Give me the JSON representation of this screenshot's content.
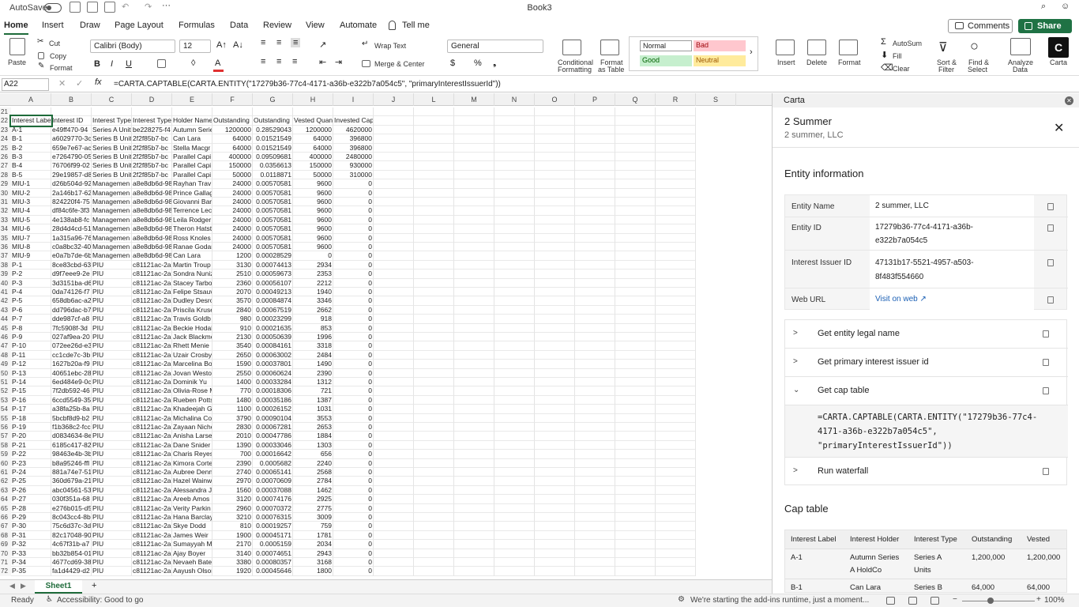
{
  "titlebar": {
    "autosave": "AutoSave",
    "title": "Book3"
  },
  "tabs": [
    "Home",
    "Insert",
    "Draw",
    "Page Layout",
    "Formulas",
    "Data",
    "Review",
    "View",
    "Automate"
  ],
  "tell_me": "Tell me",
  "comments": "Comments",
  "share": "Share",
  "ribbon": {
    "paste": "Paste",
    "cut": "Cut",
    "copy": "Copy",
    "format": "Format",
    "font_name": "Calibri (Body)",
    "font_size": "12",
    "wrap_text": "Wrap Text",
    "merge_center": "Merge & Center",
    "number_format": "General",
    "conditional_formatting_1": "Conditional",
    "conditional_formatting_2": "Formatting",
    "format_table_1": "Format",
    "format_table_2": "as Table",
    "style_normal": "Normal",
    "style_bad": "Bad",
    "style_good": "Good",
    "style_neutral": "Neutral",
    "insert": "Insert",
    "delete": "Delete",
    "format_cells": "Format",
    "autosum": "AutoSum",
    "fill": "Fill",
    "clear": "Clear",
    "sort_filter_1": "Sort &",
    "sort_filter_2": "Filter",
    "find_select_1": "Find &",
    "find_select_2": "Select",
    "analyze_1": "Analyze",
    "analyze_2": "Data",
    "carta": "Carta",
    "colors": {
      "style_normal_bg": "#ffffff",
      "style_bad_bg": "#ffc7ce",
      "style_good_bg": "#c6efce",
      "style_neutral_bg": "#ffeb9c",
      "font_color": "#e03030",
      "accent": "#1e6b3a"
    }
  },
  "formula_bar": {
    "name_box": "A22",
    "formula": "=CARTA.CAPTABLE(CARTA.ENTITY(\"17279b36-77c4-4171-a36b-e322b7a054c5\", \"primaryInterestIssuerId\"))"
  },
  "grid": {
    "columns": [
      "A",
      "B",
      "C",
      "D",
      "E",
      "F",
      "G",
      "H",
      "I",
      "J",
      "L",
      "M",
      "N",
      "O",
      "P",
      "Q",
      "R",
      "S"
    ],
    "headers": [
      "Interest Label",
      "Interest ID",
      "Interest Type",
      "Interest Type",
      "Holder Name",
      "Outstanding",
      "Outstanding",
      "Vested Quantity",
      "Invested Capital"
    ],
    "rows": [
      [
        "21",
        "",
        "",
        "",
        "",
        "",
        "",
        "",
        "",
        ""
      ],
      [
        "22",
        "Interest Label",
        "Interest ID",
        "Interest Type",
        "Interest Type",
        "Holder Name",
        "Outstanding",
        "Outstanding",
        "Vested Quan",
        "Invested Capital"
      ],
      [
        "23",
        "A-1",
        "e49ff470-94",
        "Series A Unit",
        "be228275-f4",
        "Autumn Serie",
        "1200000",
        "0.28529043",
        "1200000",
        "4620000"
      ],
      [
        "24",
        "B-1",
        "a6029770-3c",
        "Series B Unit",
        "2f2f85b7-bc",
        "Can Lara",
        "64000",
        "0.01521549",
        "64000",
        "396800"
      ],
      [
        "25",
        "B-2",
        "659e7e67-ac",
        "Series B Unit",
        "2f2f85b7-bc",
        "Stella Macgr",
        "64000",
        "0.01521549",
        "64000",
        "396800"
      ],
      [
        "26",
        "B-3",
        "e7264790-05",
        "Series B Unit",
        "2f2f85b7-bc",
        "Parallel Capi",
        "400000",
        "0.09509681",
        "400000",
        "2480000"
      ],
      [
        "27",
        "B-4",
        "76706f99-02",
        "Series B Unit",
        "2f2f85b7-bc",
        "Parallel Capi",
        "150000",
        "0.0356613",
        "150000",
        "930000"
      ],
      [
        "28",
        "B-5",
        "29e19857-d8",
        "Series B Unit",
        "2f2f85b7-bc",
        "Parallel Capi",
        "50000",
        "0.0118871",
        "50000",
        "310000"
      ],
      [
        "29",
        "MIU-1",
        "d26b504d-92",
        "Managemen",
        "a8e8db6d-98",
        "Rayhan Trav",
        "24000",
        "0.00570581",
        "9600",
        "0"
      ],
      [
        "30",
        "MIU-2",
        "2a146b17-62",
        "Managemen",
        "a8e8db6d-98",
        "Prince Gallag",
        "24000",
        "0.00570581",
        "9600",
        "0"
      ],
      [
        "31",
        "MIU-3",
        "824220f4-75",
        "Managemen",
        "a8e8db6d-98",
        "Giovanni Bar",
        "24000",
        "0.00570581",
        "9600",
        "0"
      ],
      [
        "32",
        "MIU-4",
        "df84c6fe-3f3",
        "Managemen",
        "a8e8db6d-98",
        "Terrence Lec",
        "24000",
        "0.00570581",
        "9600",
        "0"
      ],
      [
        "33",
        "MIU-5",
        "4e138ab8-fc",
        "Managemen",
        "a8e8db6d-98",
        "Leila Rodger",
        "24000",
        "0.00570581",
        "9600",
        "0"
      ],
      [
        "34",
        "MIU-6",
        "28d4d4cd-51",
        "Managemen",
        "a8e8db6d-98",
        "Theron Hatst",
        "24000",
        "0.00570581",
        "9600",
        "0"
      ],
      [
        "35",
        "MIU-7",
        "1a315a96-76",
        "Managemen",
        "a8e8db6d-98",
        "Ross Knoles",
        "24000",
        "0.00570581",
        "9600",
        "0"
      ],
      [
        "36",
        "MIU-8",
        "c0a8bc32-40",
        "Managemen",
        "a8e8db6d-98",
        "Ranae Godar",
        "24000",
        "0.00570581",
        "9600",
        "0"
      ],
      [
        "37",
        "MIU-9",
        "e0a7b7de-6b",
        "Managemen",
        "a8e8db6d-98",
        "Can Lara",
        "1200",
        "0.00028529",
        "0",
        "0"
      ],
      [
        "38",
        "P-1",
        "8ce83cbd-63",
        "PIU",
        "c81121ac-2a",
        "Martin Troup",
        "3130",
        "0.00074413",
        "2934",
        "0"
      ],
      [
        "39",
        "P-2",
        "d9f7eee9-2e",
        "PIU",
        "c81121ac-2a",
        "Sondra Nuniz",
        "2510",
        "0.00059673",
        "2353",
        "0"
      ],
      [
        "40",
        "P-3",
        "3d3151ba-d6",
        "PIU",
        "c81121ac-2a",
        "Stacey Tarbo",
        "2360",
        "0.00056107",
        "2212",
        "0"
      ],
      [
        "41",
        "P-4",
        "0da74126-f7",
        "PIU",
        "c81121ac-2a",
        "Felipe Stsauv",
        "2070",
        "0.00049213",
        "1940",
        "0"
      ],
      [
        "42",
        "P-5",
        "658db6ac-a2",
        "PIU",
        "c81121ac-2a",
        "Dudley Desro",
        "3570",
        "0.00084874",
        "3346",
        "0"
      ],
      [
        "43",
        "P-6",
        "dd796dac-b7",
        "PIU",
        "c81121ac-2a",
        "Priscila Kruse",
        "2840",
        "0.00067519",
        "2662",
        "0"
      ],
      [
        "44",
        "P-7",
        "dde987cf-a8",
        "PIU",
        "c81121ac-2a",
        "Travis Goldb",
        "980",
        "0.00023299",
        "918",
        "0"
      ],
      [
        "45",
        "P-8",
        "7fc5908f-3d",
        "PIU",
        "c81121ac-2a",
        "Beckie Hodal",
        "910",
        "0.00021635",
        "853",
        "0"
      ],
      [
        "46",
        "P-9",
        "027af9ea-20",
        "PIU",
        "c81121ac-2a",
        "Jack Blackmo",
        "2130",
        "0.00050639",
        "1996",
        "0"
      ],
      [
        "47",
        "P-10",
        "072ee26d-e3",
        "PIU",
        "c81121ac-2a",
        "Rhett Menie",
        "3540",
        "0.00084161",
        "3318",
        "0"
      ],
      [
        "48",
        "P-11",
        "cc1cde7c-3b",
        "PIU",
        "c81121ac-2a",
        "Uzair Crosby",
        "2650",
        "0.00063002",
        "2484",
        "0"
      ],
      [
        "49",
        "P-12",
        "1627b20a-f9",
        "PIU",
        "c81121ac-2a",
        "Marcelina Bo",
        "1590",
        "0.00037801",
        "1490",
        "0"
      ],
      [
        "50",
        "P-13",
        "40651ebc-28",
        "PIU",
        "c81121ac-2a",
        "Jovan Westo",
        "2550",
        "0.00060624",
        "2390",
        "0"
      ],
      [
        "51",
        "P-14",
        "6ed484e9-0c",
        "PIU",
        "c81121ac-2a",
        "Dominik Yu",
        "1400",
        "0.00033284",
        "1312",
        "0"
      ],
      [
        "52",
        "P-15",
        "7f2db592-46",
        "PIU",
        "c81121ac-2a",
        "Olivia-Rose M",
        "770",
        "0.00018306",
        "721",
        "0"
      ],
      [
        "53",
        "P-16",
        "6ccd5549-35",
        "PIU",
        "c81121ac-2a",
        "Rueben Potts",
        "1480",
        "0.00035186",
        "1387",
        "0"
      ],
      [
        "54",
        "P-17",
        "a38fa25b-8a",
        "PIU",
        "c81121ac-2a",
        "Khadeejah G",
        "1100",
        "0.00026152",
        "1031",
        "0"
      ],
      [
        "55",
        "P-18",
        "5bcbf8d9-b2",
        "PIU",
        "c81121ac-2a",
        "Michalina Co",
        "3790",
        "0.00090104",
        "3553",
        "0"
      ],
      [
        "56",
        "P-19",
        "f1b368c2-fcc",
        "PIU",
        "c81121ac-2a",
        "Zayaan Nicho",
        "2830",
        "0.00067281",
        "2653",
        "0"
      ],
      [
        "57",
        "P-20",
        "d0834634-8e",
        "PIU",
        "c81121ac-2a",
        "Anisha Larse",
        "2010",
        "0.00047786",
        "1884",
        "0"
      ],
      [
        "58",
        "P-21",
        "6185c417-82",
        "PIU",
        "c81121ac-2a",
        "Dane Snider",
        "1390",
        "0.00033046",
        "1303",
        "0"
      ],
      [
        "59",
        "P-22",
        "98463e4b-3b",
        "PIU",
        "c81121ac-2a",
        "Charis Reyes",
        "700",
        "0.00016642",
        "656",
        "0"
      ],
      [
        "60",
        "P-23",
        "b8a95246-ffl",
        "PIU",
        "c81121ac-2a",
        "Kimora Corte",
        "2390",
        "0.0005682",
        "2240",
        "0"
      ],
      [
        "61",
        "P-24",
        "881a74e7-51",
        "PIU",
        "c81121ac-2a",
        "Aubree Denn",
        "2740",
        "0.00065141",
        "2568",
        "0"
      ],
      [
        "62",
        "P-25",
        "360d679a-21",
        "PIU",
        "c81121ac-2a",
        "Hazel Wainw",
        "2970",
        "0.00070609",
        "2784",
        "0"
      ],
      [
        "63",
        "P-26",
        "abc04561-53",
        "PIU",
        "c81121ac-2a",
        "Alessandra Ji",
        "1560",
        "0.00037088",
        "1462",
        "0"
      ],
      [
        "64",
        "P-27",
        "030f351a-68",
        "PIU",
        "c81121ac-2a",
        "Areeb Amos",
        "3120",
        "0.00074176",
        "2925",
        "0"
      ],
      [
        "65",
        "P-28",
        "e276b015-d5",
        "PIU",
        "c81121ac-2a",
        "Verity Parkin",
        "2960",
        "0.00070372",
        "2775",
        "0"
      ],
      [
        "66",
        "P-29",
        "8c043cc4-8b",
        "PIU",
        "c81121ac-2a",
        "Hana Barclay",
        "3210",
        "0.00076315",
        "3009",
        "0"
      ],
      [
        "67",
        "P-30",
        "75c6d37c-3d",
        "PIU",
        "c81121ac-2a",
        "Skye Dodd",
        "810",
        "0.00019257",
        "759",
        "0"
      ],
      [
        "68",
        "P-31",
        "82c17048-90",
        "PIU",
        "c81121ac-2a",
        "James Weir",
        "1900",
        "0.00045171",
        "1781",
        "0"
      ],
      [
        "69",
        "P-32",
        "4c67f31b-a7",
        "PIU",
        "c81121ac-2a",
        "Sumayyah M",
        "2170",
        "0.0005159",
        "2034",
        "0"
      ],
      [
        "70",
        "P-33",
        "bb32b854-01",
        "PIU",
        "c81121ac-2a",
        "Ajay Boyer",
        "3140",
        "0.00074651",
        "2943",
        "0"
      ],
      [
        "71",
        "P-34",
        "4677cd69-38",
        "PIU",
        "c81121ac-2a",
        "Nevaeh Bate",
        "3380",
        "0.00080357",
        "3168",
        "0"
      ],
      [
        "72",
        "P-35",
        "fa1d4429-d2",
        "PIU",
        "c81121ac-2a",
        "Aayush Olson",
        "1920",
        "0.00045646",
        "1800",
        "0"
      ]
    ]
  },
  "sheet_tab": "Sheet1",
  "status": {
    "ready": "Ready",
    "accessibility": "Accessibility: Good to go",
    "message": "We're starting the add-ins runtime, just a moment...",
    "zoom": "100%"
  },
  "pane": {
    "header": "Carta",
    "entity_title": "2 Summer",
    "entity_subtitle": "2 summer, LLC",
    "entity_info_title": "Entity information",
    "info": [
      {
        "key": "Entity Name",
        "value": "2 summer, LLC"
      },
      {
        "key": "Entity ID",
        "value_line1": "17279b36-77c4-4171-a36b-",
        "value_line2": "e322b7a054c5"
      },
      {
        "key": "Interest Issuer ID",
        "value_line1": "47131b17-5521-4957-a503-",
        "value_line2": "8f483f554660"
      },
      {
        "key": "Web URL",
        "value": "Visit on web ↗"
      }
    ],
    "actions": [
      "Get entity legal name",
      "Get primary interest issuer id",
      "Get cap table",
      "Run waterfall"
    ],
    "code_lines": [
      "=CARTA.CAPTABLE(CARTA.ENTITY(\"17279b36-77c4-",
      "4171-a36b-e322b7a054c5\",",
      "\"primaryInterestIssuerId\"))"
    ],
    "cap_table_title": "Cap table",
    "cap_headers": [
      "Interest Label",
      "Interest Holder",
      "Interest Type",
      "Outstanding",
      "Vested"
    ],
    "cap_rows": [
      [
        "A-1",
        "Autumn Series",
        "Series A",
        "1,200,000",
        "1,200,000"
      ],
      [
        "",
        "A HoldCo",
        "Units",
        "",
        ""
      ],
      [
        "B-1",
        "Can Lara",
        "Series B",
        "64,000",
        "64,000"
      ]
    ]
  }
}
